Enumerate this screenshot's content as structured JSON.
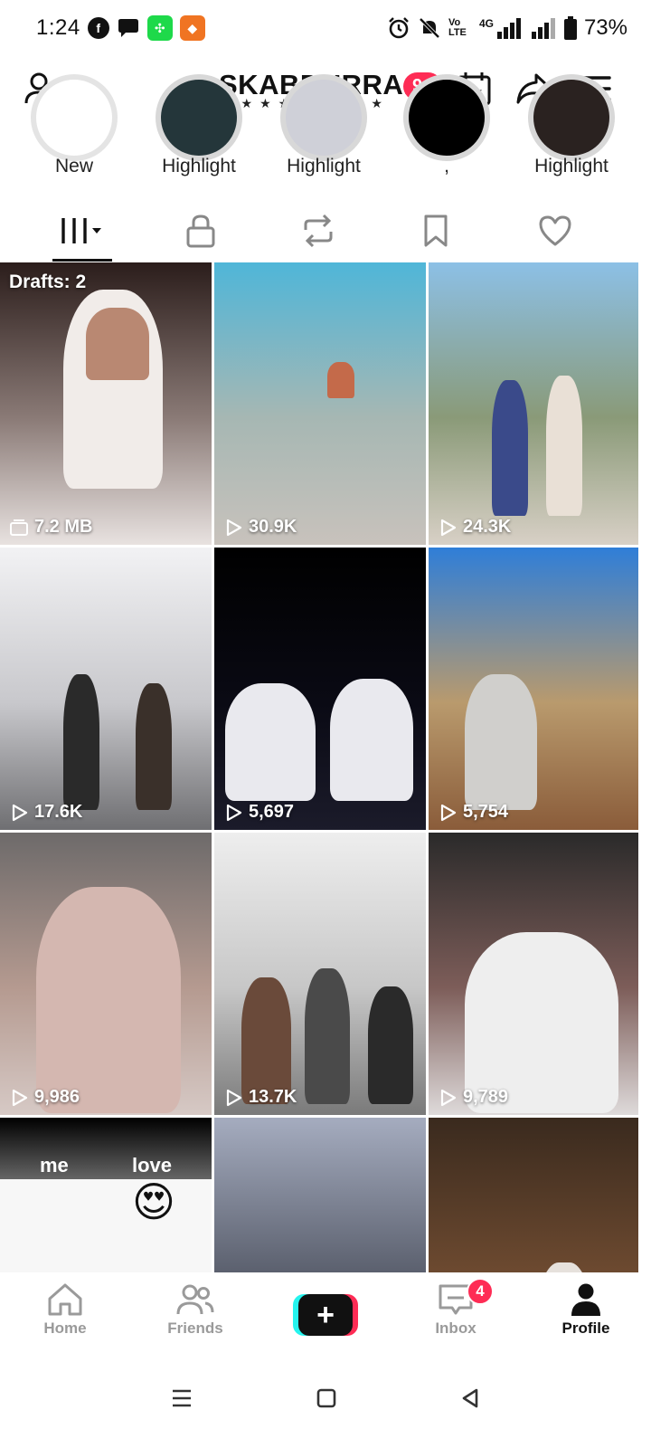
{
  "status_bar": {
    "time": "1:24",
    "app_icons": [
      "facebook-icon",
      "messenger-icon",
      "green-app-icon",
      "orange-app-icon"
    ],
    "network_label": "4G",
    "volte_label": "Vo LTE",
    "battery_percent": "73%"
  },
  "header": {
    "username": "SKABDURRA...",
    "notification_count": "9+"
  },
  "highlights": [
    {
      "label": "New"
    },
    {
      "label": "Highlight"
    },
    {
      "label": "Highlight"
    },
    {
      "label": ","
    },
    {
      "label": "Highlight"
    }
  ],
  "tabs": [
    {
      "name": "videos",
      "icon": "grid-icon",
      "active": true
    },
    {
      "name": "private",
      "icon": "lock-icon"
    },
    {
      "name": "reposts",
      "icon": "repost-icon"
    },
    {
      "name": "favorites",
      "icon": "bookmark-icon"
    },
    {
      "name": "liked",
      "icon": "heart-icon"
    }
  ],
  "grid": {
    "drafts_label": "Drafts: 2",
    "items": [
      {
        "count": "7.2 MB",
        "type": "draft",
        "colors": [
          "#2b1d1b",
          "#8a7a76",
          "#e8e2e0"
        ]
      },
      {
        "count": "30.9K",
        "colors": [
          "#4fb6d8",
          "#a6b7b3",
          "#c8c2bc"
        ]
      },
      {
        "count": "24.3K",
        "colors": [
          "#8cc0e6",
          "#8a9a78",
          "#d8d0c6"
        ]
      },
      {
        "count": "17.6K",
        "colors": [
          "#f2f2f4",
          "#c8c8cc",
          "#6f6f72"
        ]
      },
      {
        "count": "5,697",
        "colors": [
          "#000000",
          "#0a0a14",
          "#1b1b2a"
        ]
      },
      {
        "count": "5,754",
        "colors": [
          "#2f7ed8",
          "#b99a6d",
          "#8a5c3a"
        ]
      },
      {
        "count": "9,986",
        "colors": [
          "#6d6a6a",
          "#b59a90",
          "#d6c9c5"
        ]
      },
      {
        "count": "13.7K",
        "colors": [
          "#eeeeee",
          "#c7c7c7",
          "#7a7a7a"
        ]
      },
      {
        "count": "9,789",
        "colors": [
          "#2a2a2a",
          "#7d5d59",
          "#dedada"
        ]
      },
      {
        "count": "",
        "colors": [
          "#000000",
          "#ffffff",
          "#f4f4f4"
        ],
        "overlay_texts": [
          "me",
          "love"
        ]
      },
      {
        "count": "",
        "colors": [
          "#a5acbf",
          "#5b606e",
          "#2a2c33"
        ]
      },
      {
        "count": "",
        "colors": [
          "#3a2a1e",
          "#6d4a30",
          "#c2a07c"
        ]
      }
    ]
  },
  "bottom_nav": {
    "items": [
      {
        "label": "Home",
        "icon": "home-icon"
      },
      {
        "label": "Friends",
        "icon": "friends-icon"
      },
      {
        "label": "",
        "icon": "plus-icon"
      },
      {
        "label": "Inbox",
        "icon": "inbox-icon",
        "badge": "4"
      },
      {
        "label": "Profile",
        "icon": "profile-icon",
        "active": true
      }
    ]
  }
}
